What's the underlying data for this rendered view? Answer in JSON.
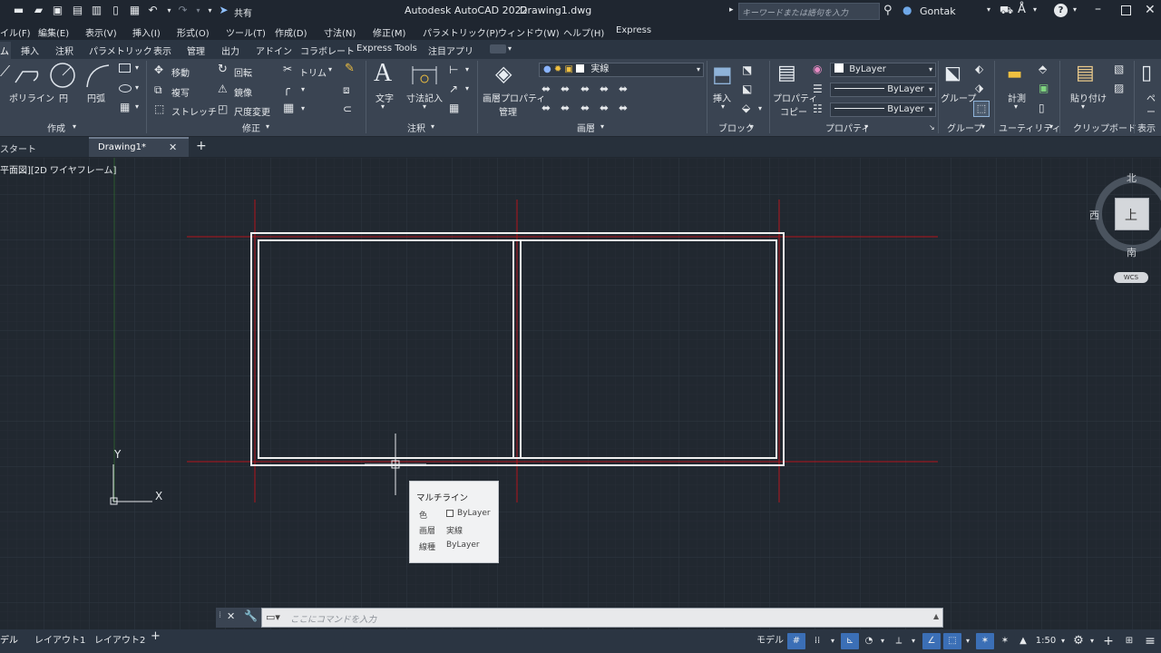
{
  "title": {
    "app": "Autodesk AutoCAD 2022",
    "file": "Drawing1.dwg",
    "share": "共有",
    "search_placeholder": "キーワードまたは語句を入力",
    "user": "Gontak"
  },
  "menus": [
    "イル(F)",
    "編集(E)",
    "表示(V)",
    "挿入(I)",
    "形式(O)",
    "ツール(T)",
    "作成(D)",
    "寸法(N)",
    "修正(M)",
    "パラメトリック(P)",
    "ウィンドウ(W)",
    "ヘルプ(H)",
    "Express"
  ],
  "ribbon_tabs": [
    "ム",
    "挿入",
    "注釈",
    "パラメトリック",
    "表示",
    "管理",
    "出力",
    "アドイン",
    "コラボレート",
    "Express Tools",
    "注目アプリ"
  ],
  "ribbon": {
    "draw": {
      "polyline": "ポリライン",
      "circle": "円",
      "arc": "円弧",
      "panel": "作成"
    },
    "modify": {
      "move": "移動",
      "rotate": "回転",
      "trim": "トリム",
      "copy": "複写",
      "mirror": "鏡像",
      "stretch": "ストレッチ",
      "scale": "尺度変更",
      "panel": "修正"
    },
    "annotation": {
      "text": "文字",
      "dimension": "寸法記入",
      "panel": "注釈"
    },
    "layers": {
      "props": "画層プロパティ",
      "manage": "管理",
      "current": "実線",
      "panel": "画層"
    },
    "block": {
      "insert": "挿入",
      "panel": "ブロック"
    },
    "properties": {
      "prop": "プロパティ",
      "copy": "コピー",
      "color": "ByLayer",
      "lineweight": "ByLayer",
      "linetype": "ByLayer",
      "panel": "プロパティ"
    },
    "groups": {
      "group": "グループ",
      "panel": "グループ"
    },
    "utilities": {
      "measure": "計測",
      "panel": "ユーティリティ"
    },
    "clipboard": {
      "paste": "貼り付け",
      "panel": "クリップボード"
    },
    "view": {
      "paste": "ペー",
      "panel": "表示"
    }
  },
  "doc_tabs": {
    "start": "スタート",
    "drawing": "Drawing1*"
  },
  "viewport_label": "平面図][2D ワイヤフレーム]",
  "viewcube": {
    "top": "上",
    "north": "北",
    "south": "南",
    "west": "西",
    "wcs": "WCS"
  },
  "ucs": {
    "x": "X",
    "y": "Y"
  },
  "tooltip": {
    "title": "マルチライン",
    "rows": [
      {
        "label": "色",
        "value": "ByLayer"
      },
      {
        "label": "画層",
        "value": "実線"
      },
      {
        "label": "線種",
        "value": "ByLayer"
      }
    ]
  },
  "command": {
    "placeholder": "ここにコマンドを入力"
  },
  "layout_tabs": [
    "デル",
    "レイアウト1",
    "レイアウト2"
  ],
  "status": {
    "model": "モデル",
    "scale": "1:50"
  },
  "colors": {
    "accent": "#3b6fb6",
    "canvas": "#212830",
    "ribbon": "#3a4452"
  }
}
